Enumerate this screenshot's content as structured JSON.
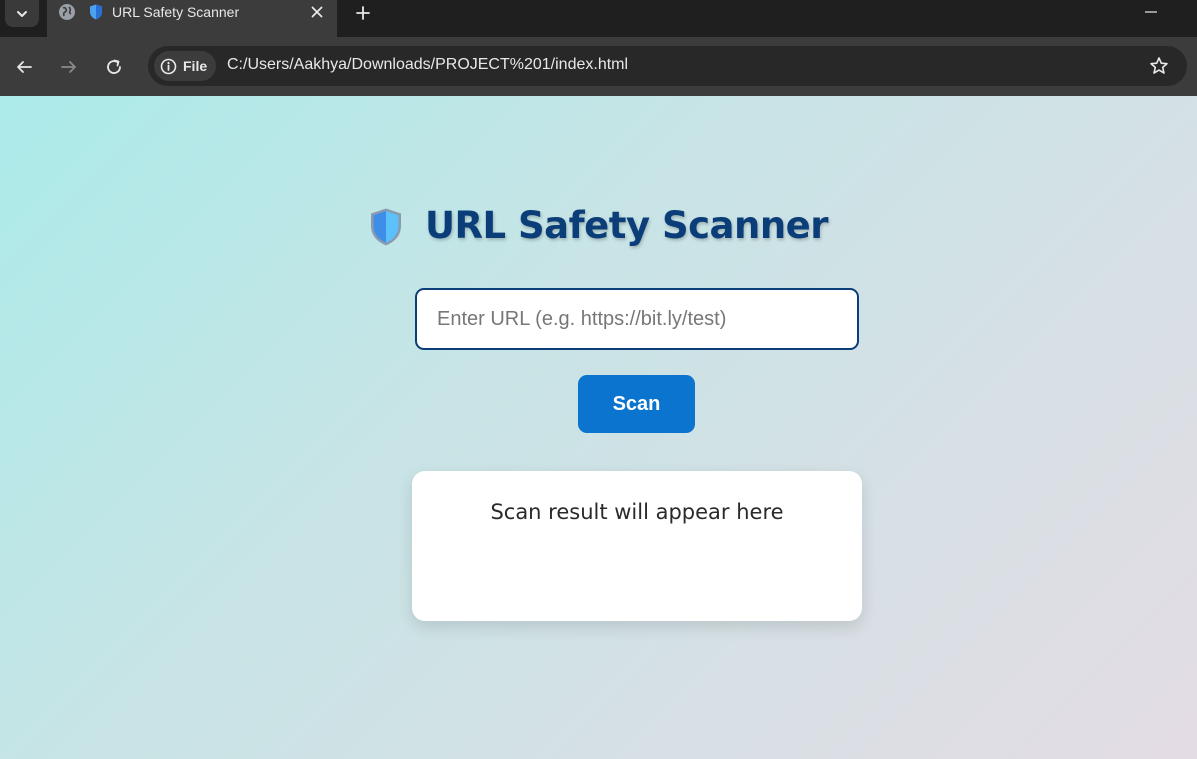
{
  "browser": {
    "tab": {
      "title": "URL Safety Scanner",
      "favicon": "shield-icon"
    },
    "address_bar": {
      "chip_label": "File",
      "url": "C:/Users/Aakhya/Downloads/PROJECT%201/index.html"
    },
    "icons": {
      "tab_search": "chevron-down-icon",
      "globe": "globe-icon",
      "close": "close-icon",
      "new_tab": "plus-icon",
      "minimize": "minimize-icon",
      "back": "arrow-left-icon",
      "forward": "arrow-right-icon",
      "reload": "reload-icon",
      "info": "info-icon",
      "bookmark": "star-icon"
    }
  },
  "page": {
    "heading": "URL Safety Scanner",
    "input": {
      "placeholder": "Enter URL (e.g. https://bit.ly/test)",
      "value": ""
    },
    "scan_button_label": "Scan",
    "result_text": "Scan result will appear here",
    "colors": {
      "heading": "#0b3e79",
      "button": "#0b74ce",
      "input_border": "#0b3e79",
      "background_start": "#abebe9",
      "background_end": "#e4dce4"
    }
  }
}
